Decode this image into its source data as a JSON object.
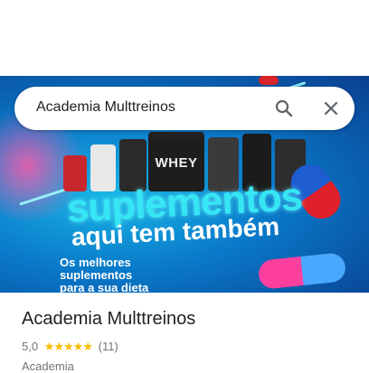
{
  "search": {
    "query": "Academia Multtreinos"
  },
  "icons": {
    "search": "search-icon",
    "close": "close-icon"
  },
  "banner": {
    "product_label": "WHEY",
    "headline": "suplementos",
    "subheadline": "aqui tem também",
    "tagline_1": "Os melhores",
    "tagline_2": "suplementos",
    "tagline_3": "para a sua dieta"
  },
  "place": {
    "name": "Academia Multtreinos",
    "rating": "5,0",
    "stars": "★★★★★",
    "review_count": "(11)",
    "category": "Academia"
  },
  "colors": {
    "star": "#fbbc04",
    "headline_cyan": "#36e6f4"
  }
}
